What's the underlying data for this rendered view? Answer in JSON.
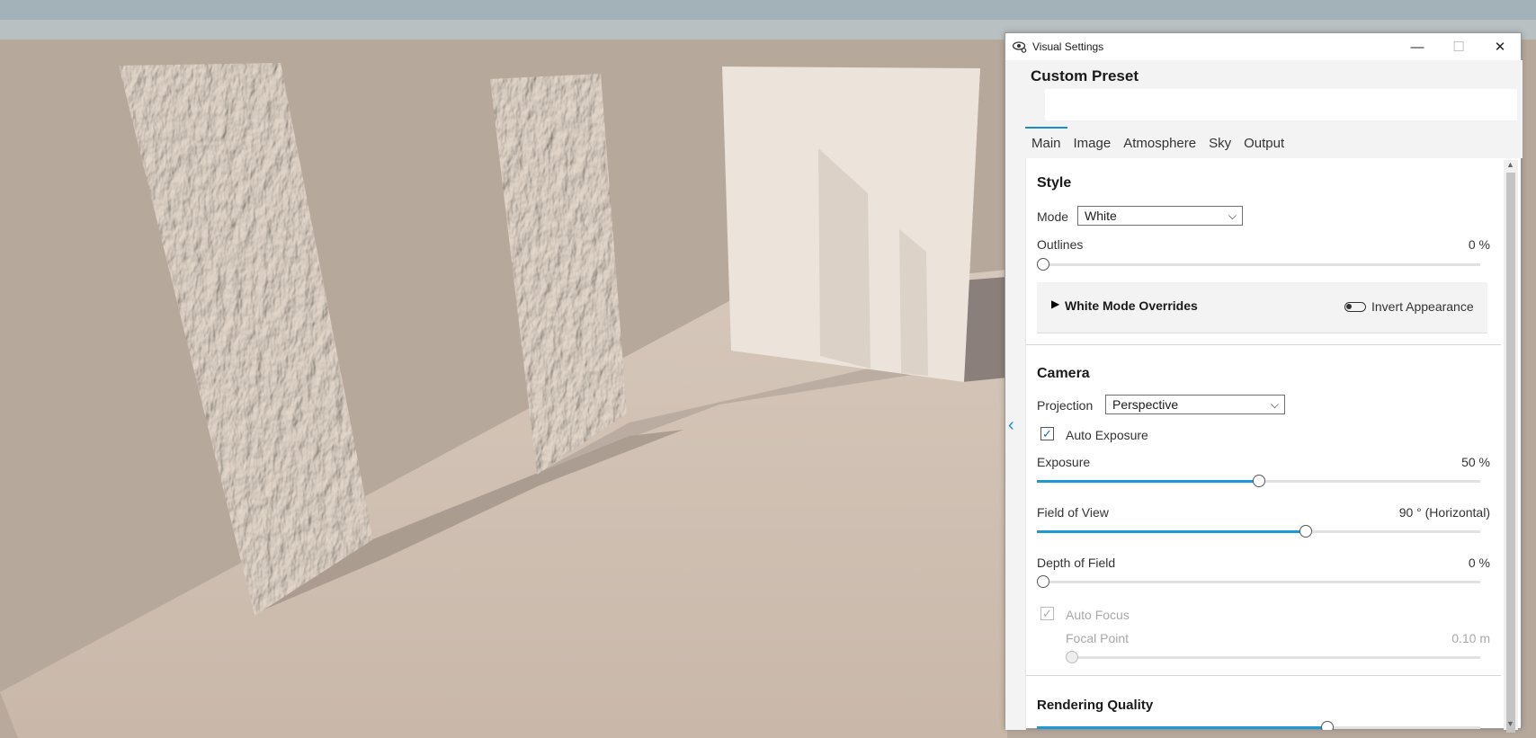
{
  "window": {
    "title": "Visual Settings",
    "icon": "eye-gear-icon",
    "minimize_icon": "minimize-icon",
    "maximize_icon": "maximize-icon",
    "close_icon": "close-icon",
    "minimize_glyph": "—",
    "maximize_glyph": "☐",
    "close_glyph": "✕"
  },
  "preset": {
    "title": "Custom Preset"
  },
  "tabs": [
    {
      "label": "Main",
      "active": true
    },
    {
      "label": "Image",
      "active": false
    },
    {
      "label": "Atmosphere",
      "active": false
    },
    {
      "label": "Sky",
      "active": false
    },
    {
      "label": "Output",
      "active": false
    }
  ],
  "style": {
    "heading": "Style",
    "mode_label": "Mode",
    "mode_value": "White",
    "outlines_label": "Outlines",
    "outlines_value": "0 %",
    "outlines_level": 0,
    "overrides_label": "White Mode Overrides",
    "invert_label": "Invert Appearance",
    "invert_on": false
  },
  "camera": {
    "heading": "Camera",
    "projection_label": "Projection",
    "projection_value": "Perspective",
    "auto_exposure_label": "Auto Exposure",
    "auto_exposure_checked": true,
    "exposure_label": "Exposure",
    "exposure_value": "50 %",
    "exposure_level": 0.5,
    "fov_label": "Field of View",
    "fov_value": "90 ° (Horizontal)",
    "fov_level": 0.61,
    "dof_label": "Depth of Field",
    "dof_value": "0 %",
    "dof_level": 0,
    "auto_focus_label": "Auto Focus",
    "auto_focus_checked": true,
    "focal_point_label": "Focal Point",
    "focal_point_value": "0.10 m",
    "focal_point_level": 0
  },
  "rendering": {
    "heading": "Rendering Quality",
    "quality_level": 0.66
  },
  "colors": {
    "accent": "#1a9ad6",
    "panel_bg": "#f3f3f3"
  }
}
